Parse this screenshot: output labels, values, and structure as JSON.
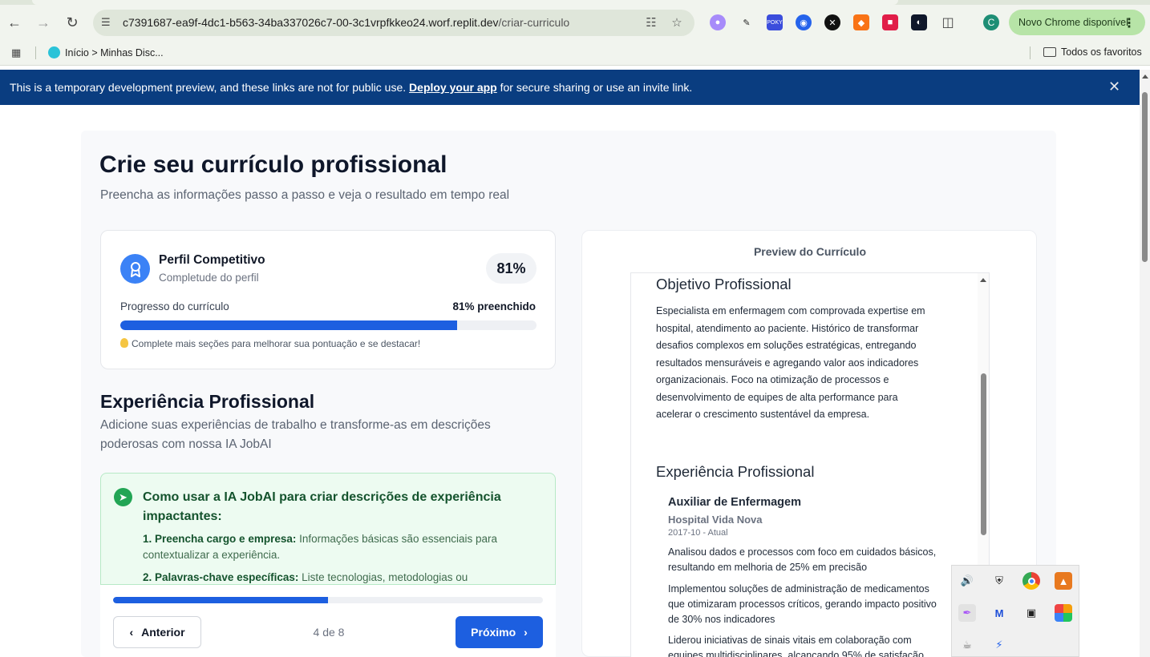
{
  "browser": {
    "url_host": "c7391687-ea9f-4dc1-b563-34ba337026c7-00-3c1vrpfkkeo24.worf.replit.dev",
    "url_path": "/criar-curriculo",
    "update_label": "Novo Chrome disponível",
    "avatar_letter": "C",
    "bookmarks": [
      {
        "label": "Início > Minhas Disc..."
      }
    ],
    "all_bookmarks": "Todos os favoritos"
  },
  "banner": {
    "text_before": "This is a temporary development preview, and these links are not for public use.",
    "link": "Deploy your app",
    "text_after": "for secure sharing or use an invite link."
  },
  "page": {
    "title": "Crie seu currículo profissional",
    "subtitle": "Preencha as informações passo a passo e veja o resultado em tempo real"
  },
  "score": {
    "title": "Perfil Competitivo",
    "subtitle": "Completude do perfil",
    "badge": "81%",
    "progress_label": "Progresso do currículo",
    "progress_value_label": "81% preenchido",
    "progress_fraction": 0.81,
    "tip": "Complete mais seções para melhorar sua pontuação e se destacar!"
  },
  "section": {
    "title": "Experiência Profissional",
    "description": "Adicione suas experiências de trabalho e transforme-as em descrições poderosas com nossa IA JobAI"
  },
  "tips": {
    "title": "Como usar a IA JobAI para criar descrições de experiência impactantes:",
    "items": [
      {
        "bold": "1. Preencha cargo e empresa:",
        "text": "Informações básicas são essenciais para contextualizar a experiência."
      },
      {
        "bold": "2. Palavras-chave específicas:",
        "text": "Liste tecnologias, metodologias ou"
      }
    ]
  },
  "navigation": {
    "step_fraction": 0.5,
    "prev_label": "Anterior",
    "step_label": "4 de 8",
    "next_label": "Próximo"
  },
  "preview": {
    "title": "Preview do Currículo",
    "objective_heading": "Objetivo Profissional",
    "objective_text": "Especialista em enfermagem com comprovada expertise em hospital, atendimento ao paciente. Histórico de transformar desafios complexos em soluções estratégicas, entregando resultados mensuráveis e agregando valor aos indicadores organizacionais. Foco na otimização de processos e desenvolvimento de equipes de alta performance para acelerar o crescimento sustentável da empresa.",
    "experience_heading": "Experiência Profissional",
    "job": {
      "title": "Auxiliar de Enfermagem",
      "company": "Hospital Vida Nova",
      "dates": "2017-10 - Atual",
      "bullets": [
        "Analisou dados e processos com foco em cuidados básicos, resultando em melhoria de 25% em precisão",
        "Implementou soluções de administração de medicamentos que otimizaram processos críticos, gerando impacto positivo de 30% nos indicadores",
        "Liderou iniciativas de sinais vitais em colaboração com equipes multidisciplinares, alcançando 95% de satisfação"
      ]
    }
  },
  "colors": {
    "primary": "#1d5fe0",
    "banner": "#0a3d80",
    "tips_bg": "#edfbf1"
  }
}
